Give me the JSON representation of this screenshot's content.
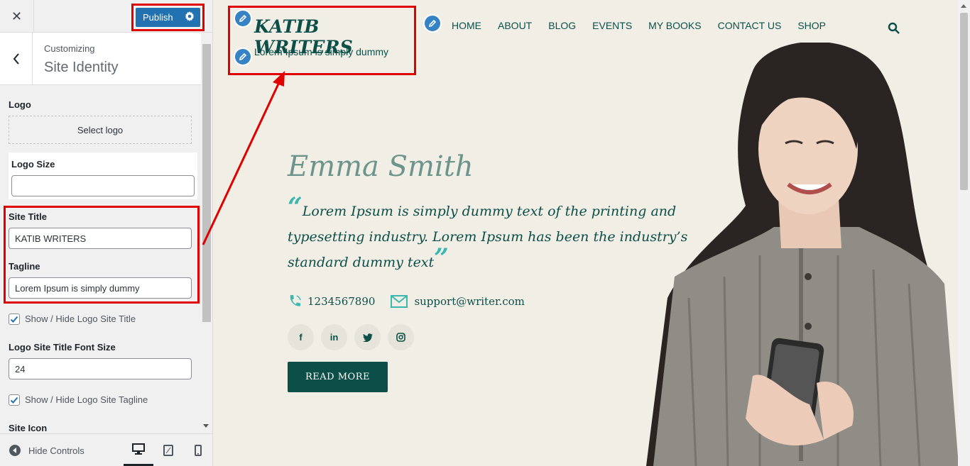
{
  "customizer": {
    "close_icon": "close-icon",
    "publish_label": "Publish",
    "breadcrumb": "Customizing",
    "section_title": "Site Identity",
    "logo_label": "Logo",
    "select_logo": "Select logo",
    "logo_size_label": "Logo Size",
    "logo_size_value": "",
    "site_title_label": "Site Title",
    "site_title_value": "KATIB WRITERS",
    "tagline_label": "Tagline",
    "tagline_value": "Lorem Ipsum is simply dummy",
    "show_title_label": "Show / Hide Logo Site Title",
    "show_title_checked": true,
    "font_size_label": "Logo Site Title Font Size",
    "font_size_value": "24",
    "show_tagline_label": "Show / Hide Logo Site Tagline",
    "show_tagline_checked": true,
    "site_icon_label": "Site Icon",
    "hide_controls": "Hide Controls",
    "devices": [
      "desktop",
      "tablet",
      "mobile"
    ]
  },
  "site": {
    "title": "KATIB WRITERS",
    "tagline": "Lorem Ipsum is simply dummy",
    "nav": [
      "HOME",
      "ABOUT",
      "BLOG",
      "EVENTS",
      "MY BOOKS",
      "CONTACT US",
      "SHOP"
    ],
    "hero": {
      "name": "Emma Smith",
      "quote": "Lorem Ipsum is simply dummy text of the printing and typesetting industry. Lorem Ipsum has been the industry’s standard dummy text",
      "phone": "1234567890",
      "email": "support@writer.com",
      "socials": [
        "f",
        "in",
        "twitter",
        "instagram"
      ],
      "cta": "READ MORE"
    }
  },
  "colors": {
    "accent": "#2271b1",
    "brand": "#0c4f48",
    "highlight": "#e00000",
    "quote_mark": "#39b8b0"
  }
}
